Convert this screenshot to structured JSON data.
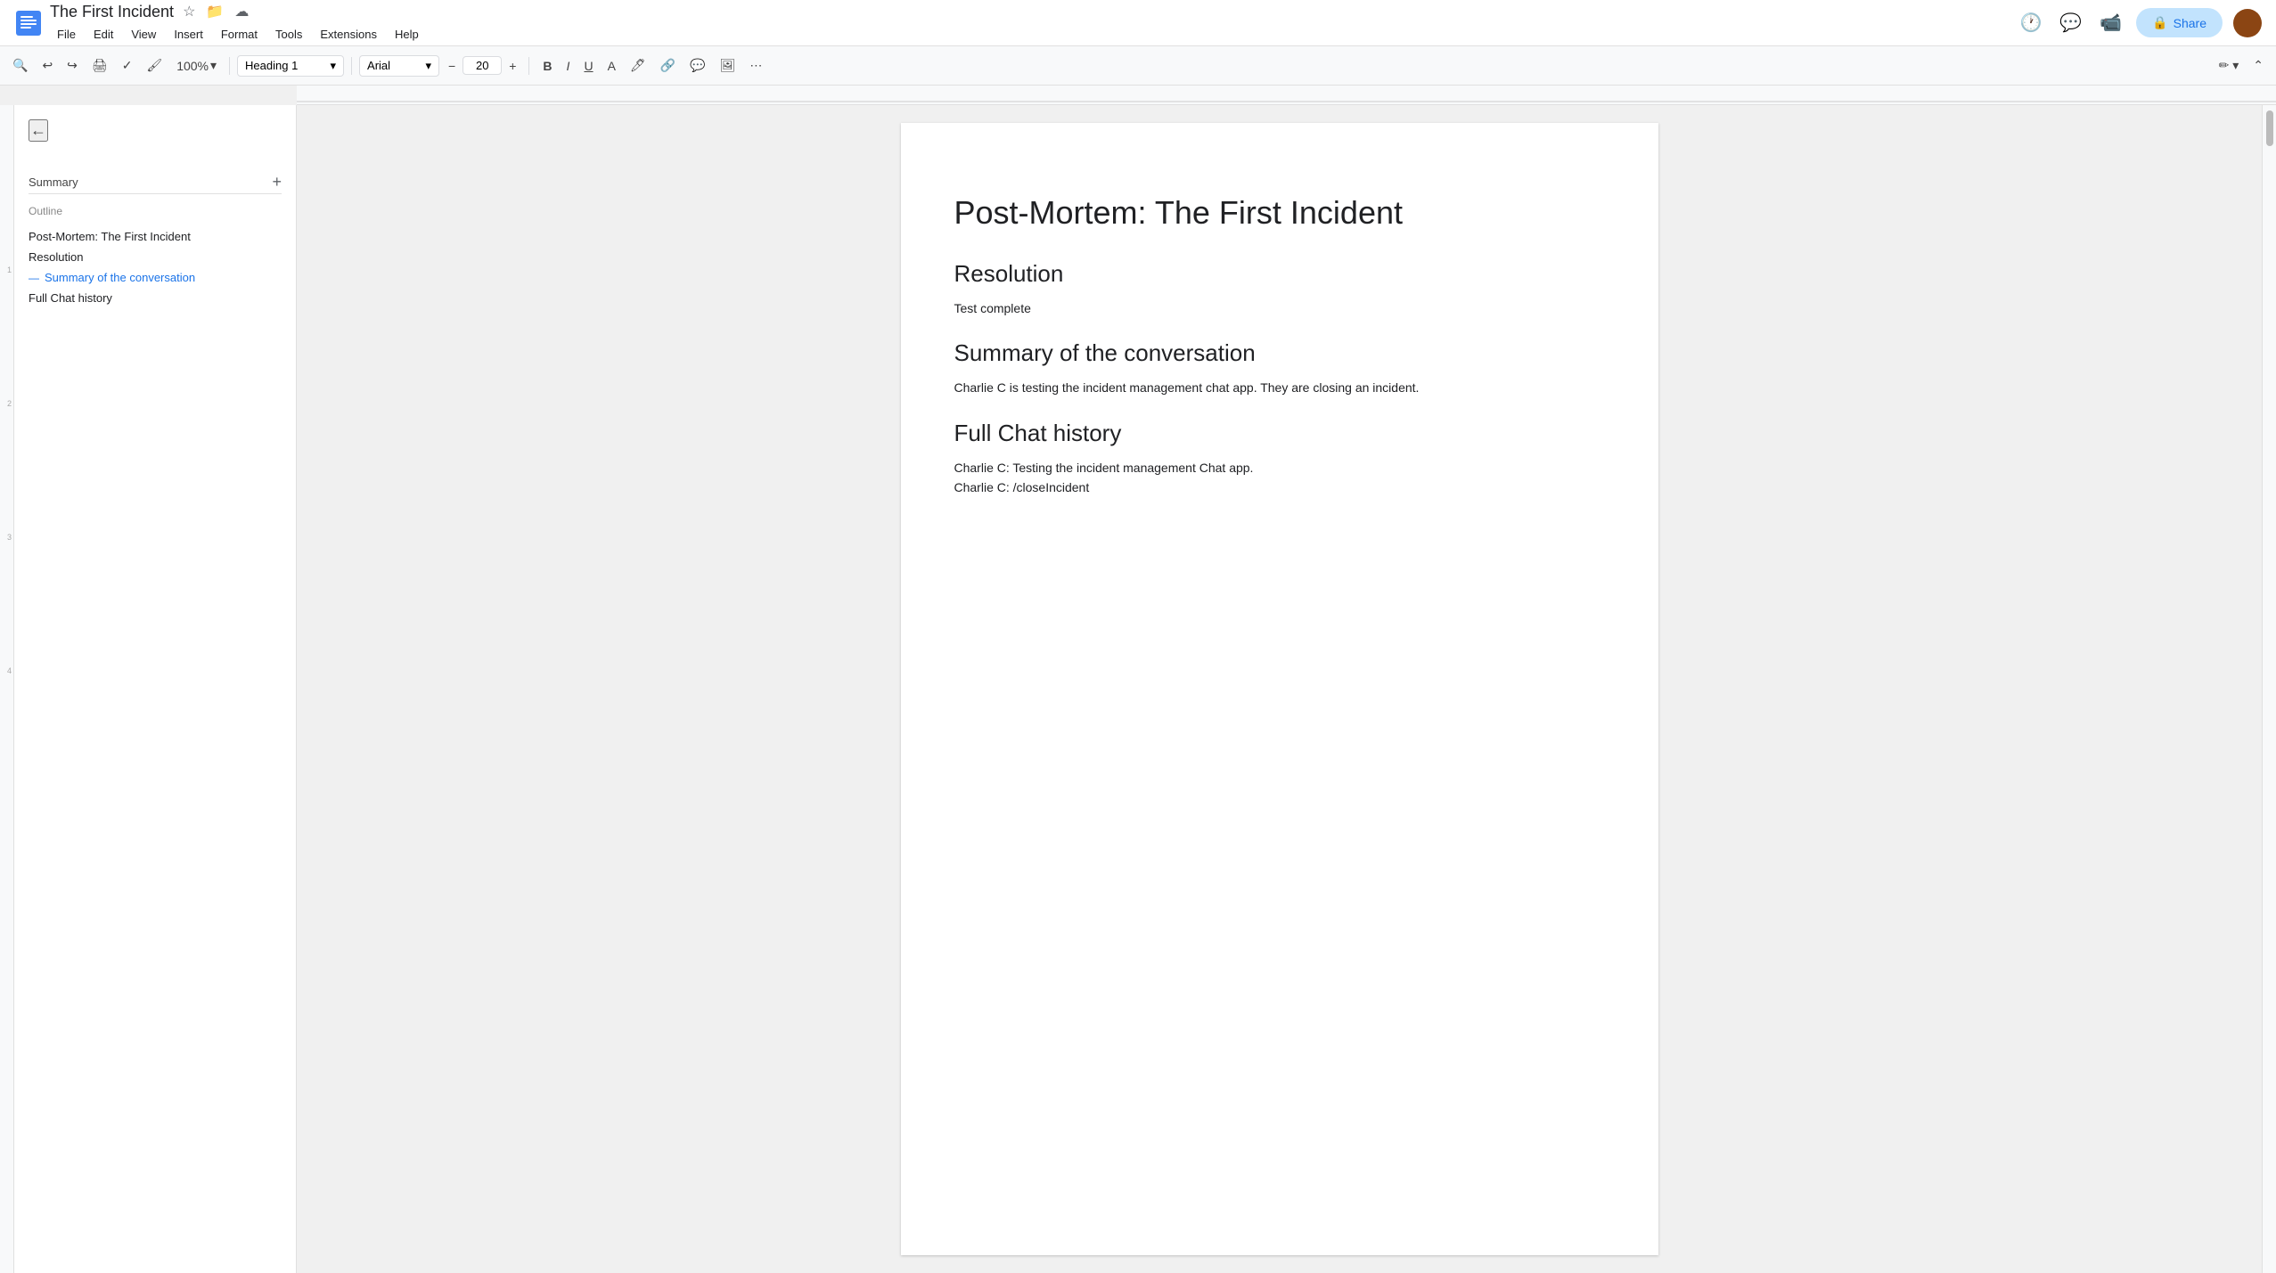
{
  "titleBar": {
    "docTitle": "The First Incident",
    "menuItems": [
      "File",
      "Edit",
      "View",
      "Insert",
      "Format",
      "Tools",
      "Extensions",
      "Help"
    ],
    "shareLabel": "Share"
  },
  "toolbar": {
    "zoom": "100%",
    "styleSelector": "Heading 1",
    "fontSelector": "Arial",
    "fontSize": "20",
    "boldLabel": "B",
    "italicLabel": "I",
    "underlineLabel": "U"
  },
  "sidebar": {
    "sectionTitle": "Summary",
    "outlineLabel": "Outline",
    "outlineItems": [
      {
        "label": "Post-Mortem: The First Incident",
        "active": false
      },
      {
        "label": "Resolution",
        "active": false
      },
      {
        "label": "Summary of the conversation",
        "active": true
      },
      {
        "label": "Full Chat history",
        "active": false
      }
    ]
  },
  "document": {
    "mainTitle": "Post-Mortem: The First Incident",
    "sections": [
      {
        "heading": "Resolution",
        "body": "Test complete"
      },
      {
        "heading": "Summary of the conversation",
        "body": "Charlie C is testing the incident management chat app. They are closing an incident."
      },
      {
        "heading": "Full Chat history",
        "body": "Charlie C: Testing the incident management Chat app.\nCharlie C: /closeIncident"
      }
    ]
  }
}
